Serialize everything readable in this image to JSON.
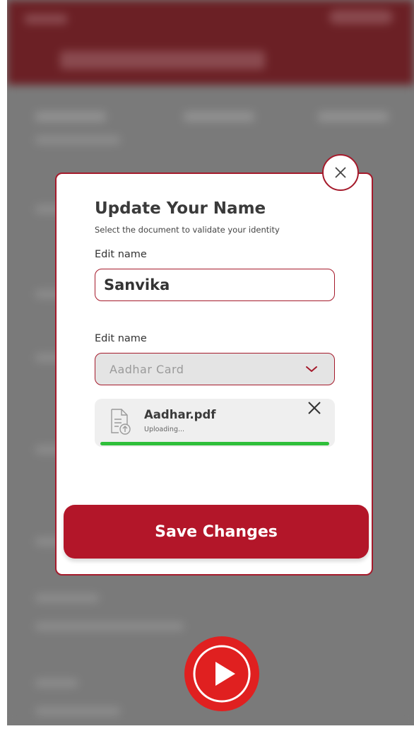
{
  "dialog": {
    "title": "Update Your Name",
    "subtitle": "Select the document to validate your identity",
    "name_label": "Edit name",
    "name_value": "Sanvika",
    "document_label": "Edit name",
    "document_selected": "Aadhar Card",
    "file": {
      "name": "Aadhar.pdf",
      "status": "Uploading...",
      "progress": 1.0
    },
    "save_label": "Save Changes"
  },
  "colors": {
    "accent": "#b31629",
    "border": "#a51a2b",
    "progress": "#2fbf3a",
    "play": "#e02020"
  },
  "icons": {
    "close": "close-icon",
    "chevron": "chevron-down-icon",
    "file": "file-upload-icon",
    "remove": "close-icon",
    "play": "play-icon"
  }
}
